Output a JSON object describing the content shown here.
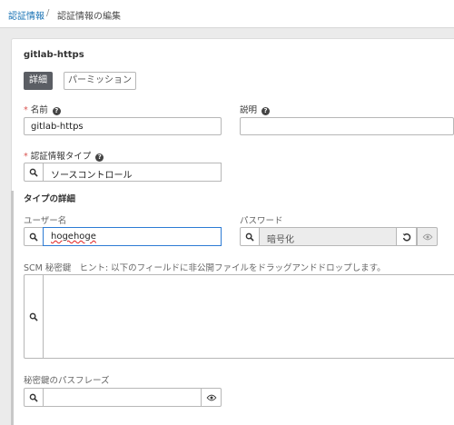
{
  "breadcrumb": {
    "link": "認証情報",
    "separator": "/",
    "current": "認証情報の編集"
  },
  "card": {
    "title": "gitlab-https"
  },
  "tabs": {
    "details": "詳細",
    "permissions": "パーミッション"
  },
  "form": {
    "name_label": "名前",
    "name_value": "gitlab-https",
    "description_label": "説明",
    "description_value": "",
    "credential_type_label": "認証情報タイプ",
    "credential_type_value": "ソースコントロール",
    "type_details_label": "タイプの詳細",
    "username_label": "ユーザー名",
    "username_value": "hogehoge",
    "password_label": "パスワード",
    "password_value": "暗号化",
    "scm_key_label": "SCM 秘密鍵",
    "scm_key_hint": "ヒント: 以下のフィールドに非公開ファイルをドラッグアンドドロップします。",
    "passphrase_label": "秘密鍵のパスフレーズ",
    "passphrase_value": "",
    "required_mark": "*",
    "help_glyph": "?"
  },
  "icons": {
    "search": "search-icon",
    "revert": "revert-icon",
    "show": "eye-icon",
    "help": "help-icon"
  },
  "colors": {
    "link": "#1a73b5",
    "required": "#d9534f",
    "active_tab": "#5b5e64",
    "focus_border": "#2d7bd4",
    "readonly_bg": "#ececec"
  }
}
